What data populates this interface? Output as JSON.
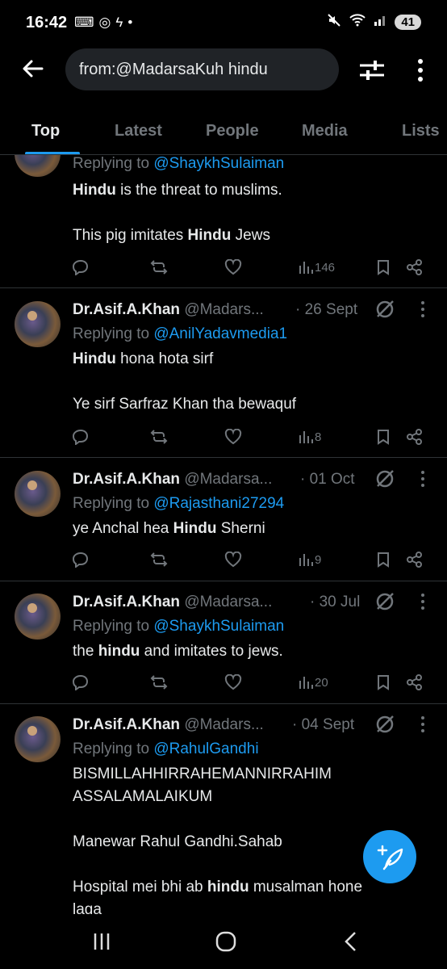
{
  "status_bar": {
    "time": "16:42",
    "battery": "41"
  },
  "search": {
    "query": "from:@MadarsaKuh hindu"
  },
  "tabs": [
    {
      "label": "Top"
    },
    {
      "label": "Latest"
    },
    {
      "label": "People"
    },
    {
      "label": "Media"
    },
    {
      "label": "Lists"
    }
  ],
  "tweets": [
    {
      "reply_prefix": "Replying to ",
      "reply_to": "@ShaykhSulaiman",
      "lines": [
        [
          {
            "t": "Hindu",
            "b": true
          },
          {
            "t": " is the threat to muslims.",
            "b": false
          }
        ],
        [],
        [
          {
            "t": "This pig imitates ",
            "b": false
          },
          {
            "t": "Hindu",
            "b": true
          },
          {
            "t": " Jews",
            "b": false
          }
        ]
      ],
      "views": "146"
    },
    {
      "name": "Dr.Asif.A.Khan",
      "handle": "@Madars...",
      "date": "· 26 Sept",
      "reply_prefix": "Replying to ",
      "reply_to": "@AnilYadavmedia1",
      "lines": [
        [
          {
            "t": "Hindu",
            "b": true
          },
          {
            "t": " hona hota sirf",
            "b": false
          }
        ],
        [],
        [
          {
            "t": "Ye sirf Sarfraz Khan tha bewaquf",
            "b": false
          }
        ]
      ],
      "views": "8"
    },
    {
      "name": "Dr.Asif.A.Khan",
      "handle": "@Madarsa...",
      "date": "· 01 Oct",
      "reply_prefix": "Replying to ",
      "reply_to": "@Rajasthani27294",
      "lines": [
        [
          {
            "t": "ye Anchal hea ",
            "b": false
          },
          {
            "t": "Hindu",
            "b": true
          },
          {
            "t": " Sherni",
            "b": false
          }
        ]
      ],
      "views": "9"
    },
    {
      "name": "Dr.Asif.A.Khan",
      "handle": "@Madarsa...",
      "date": "· 30 Jul",
      "reply_prefix": "Replying to ",
      "reply_to": "@ShaykhSulaiman",
      "lines": [
        [
          {
            "t": "the ",
            "b": false
          },
          {
            "t": "hindu",
            "b": true
          },
          {
            "t": " and imitates to jews.",
            "b": false
          }
        ]
      ],
      "views": "20"
    },
    {
      "name": "Dr.Asif.A.Khan",
      "handle": "@Madars...",
      "date": "· 04 Sept",
      "reply_prefix": "Replying to ",
      "reply_to": "@RahulGandhi",
      "lines": [
        [
          {
            "t": "BISMILLAHHIRRAHEMANNIRRAHIM",
            "b": false
          }
        ],
        [
          {
            "t": "ASSALAMALAIKUM",
            "b": false
          }
        ],
        [],
        [
          {
            "t": "Manewar Rahul Gandhi.Sahab",
            "b": false
          }
        ],
        [],
        [
          {
            "t": "Hospital mei bhi ab ",
            "b": false
          },
          {
            "t": "hindu",
            "b": true
          },
          {
            "t": " musalman hone",
            "b": false
          }
        ],
        [
          {
            "t": "laga",
            "b": false
          }
        ]
      ]
    }
  ]
}
